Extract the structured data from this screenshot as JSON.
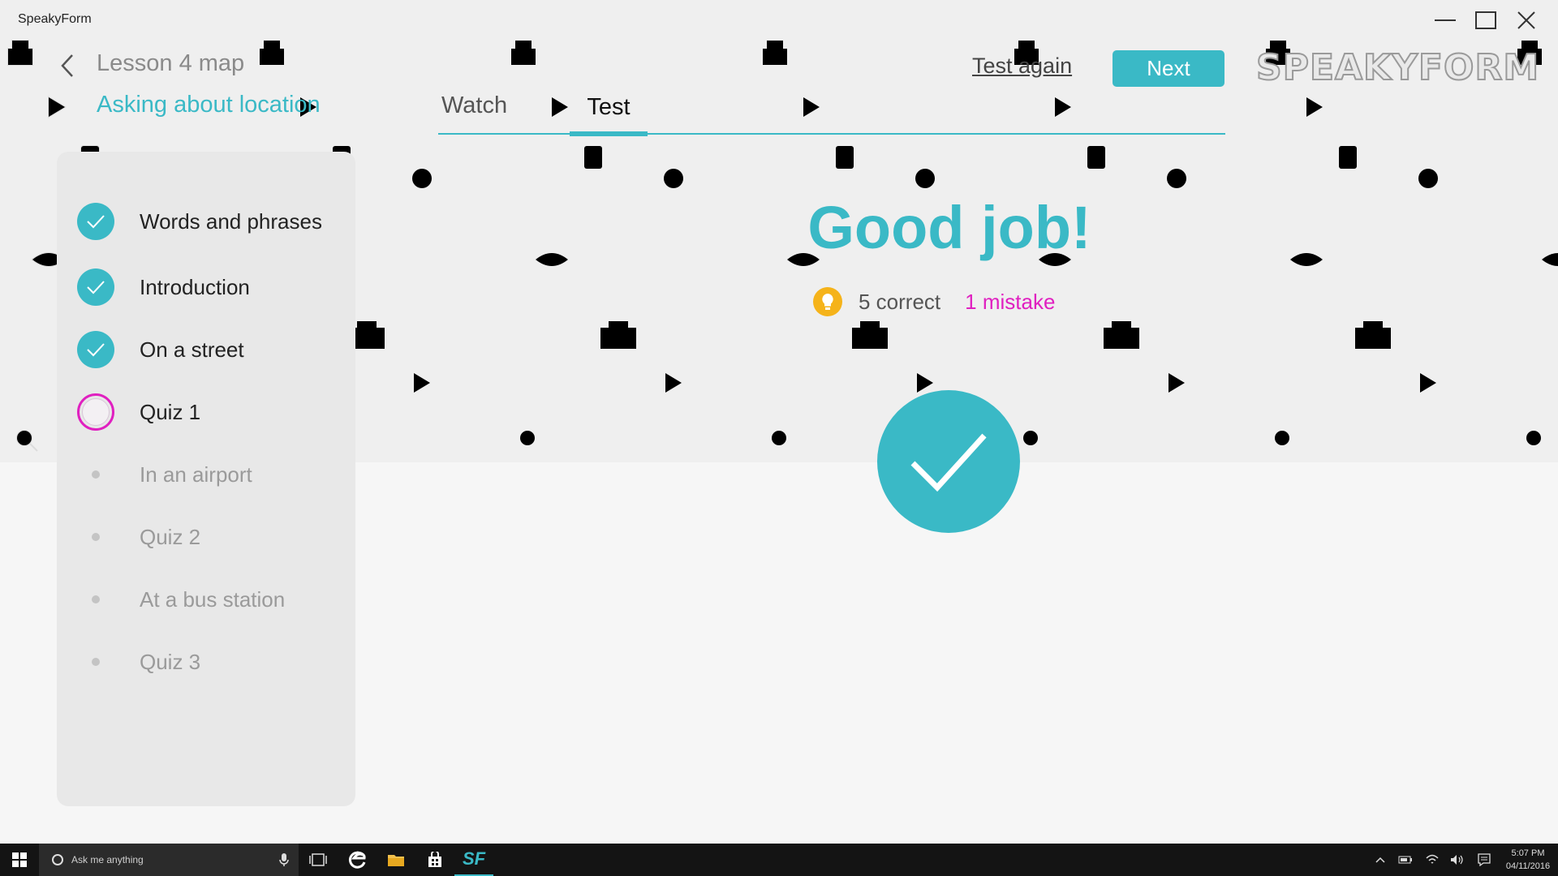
{
  "window": {
    "title": "SpeakyForm"
  },
  "header": {
    "lesson_map": "Lesson 4 map",
    "subtitle": "Asking about location",
    "test_again": "Test again",
    "next": "Next",
    "brand": "SPEAKYFORM"
  },
  "tabs": [
    {
      "label": "Watch",
      "active": false
    },
    {
      "label": "Test",
      "active": true
    }
  ],
  "sidebar": {
    "items": [
      {
        "label": "Words and phrases",
        "status": "done"
      },
      {
        "label": "Introduction",
        "status": "done"
      },
      {
        "label": "On a street",
        "status": "done"
      },
      {
        "label": "Quiz 1",
        "status": "current"
      },
      {
        "label": "In an airport",
        "status": "locked"
      },
      {
        "label": "Quiz 2",
        "status": "locked"
      },
      {
        "label": "At a bus station",
        "status": "locked"
      },
      {
        "label": "Quiz 3",
        "status": "locked"
      }
    ]
  },
  "result": {
    "headline": "Good job!",
    "correct": "5 correct",
    "mistakes": "1 mistake"
  },
  "taskbar": {
    "search_placeholder": "Ask me anything",
    "app_label": "SF",
    "time": "5:07 PM",
    "date": "04/11/2016"
  },
  "colors": {
    "accent": "#3ab9c6",
    "mistake": "#e020c0",
    "bulb": "#f5b31a",
    "sidebar_bg": "#e8e8e8"
  }
}
